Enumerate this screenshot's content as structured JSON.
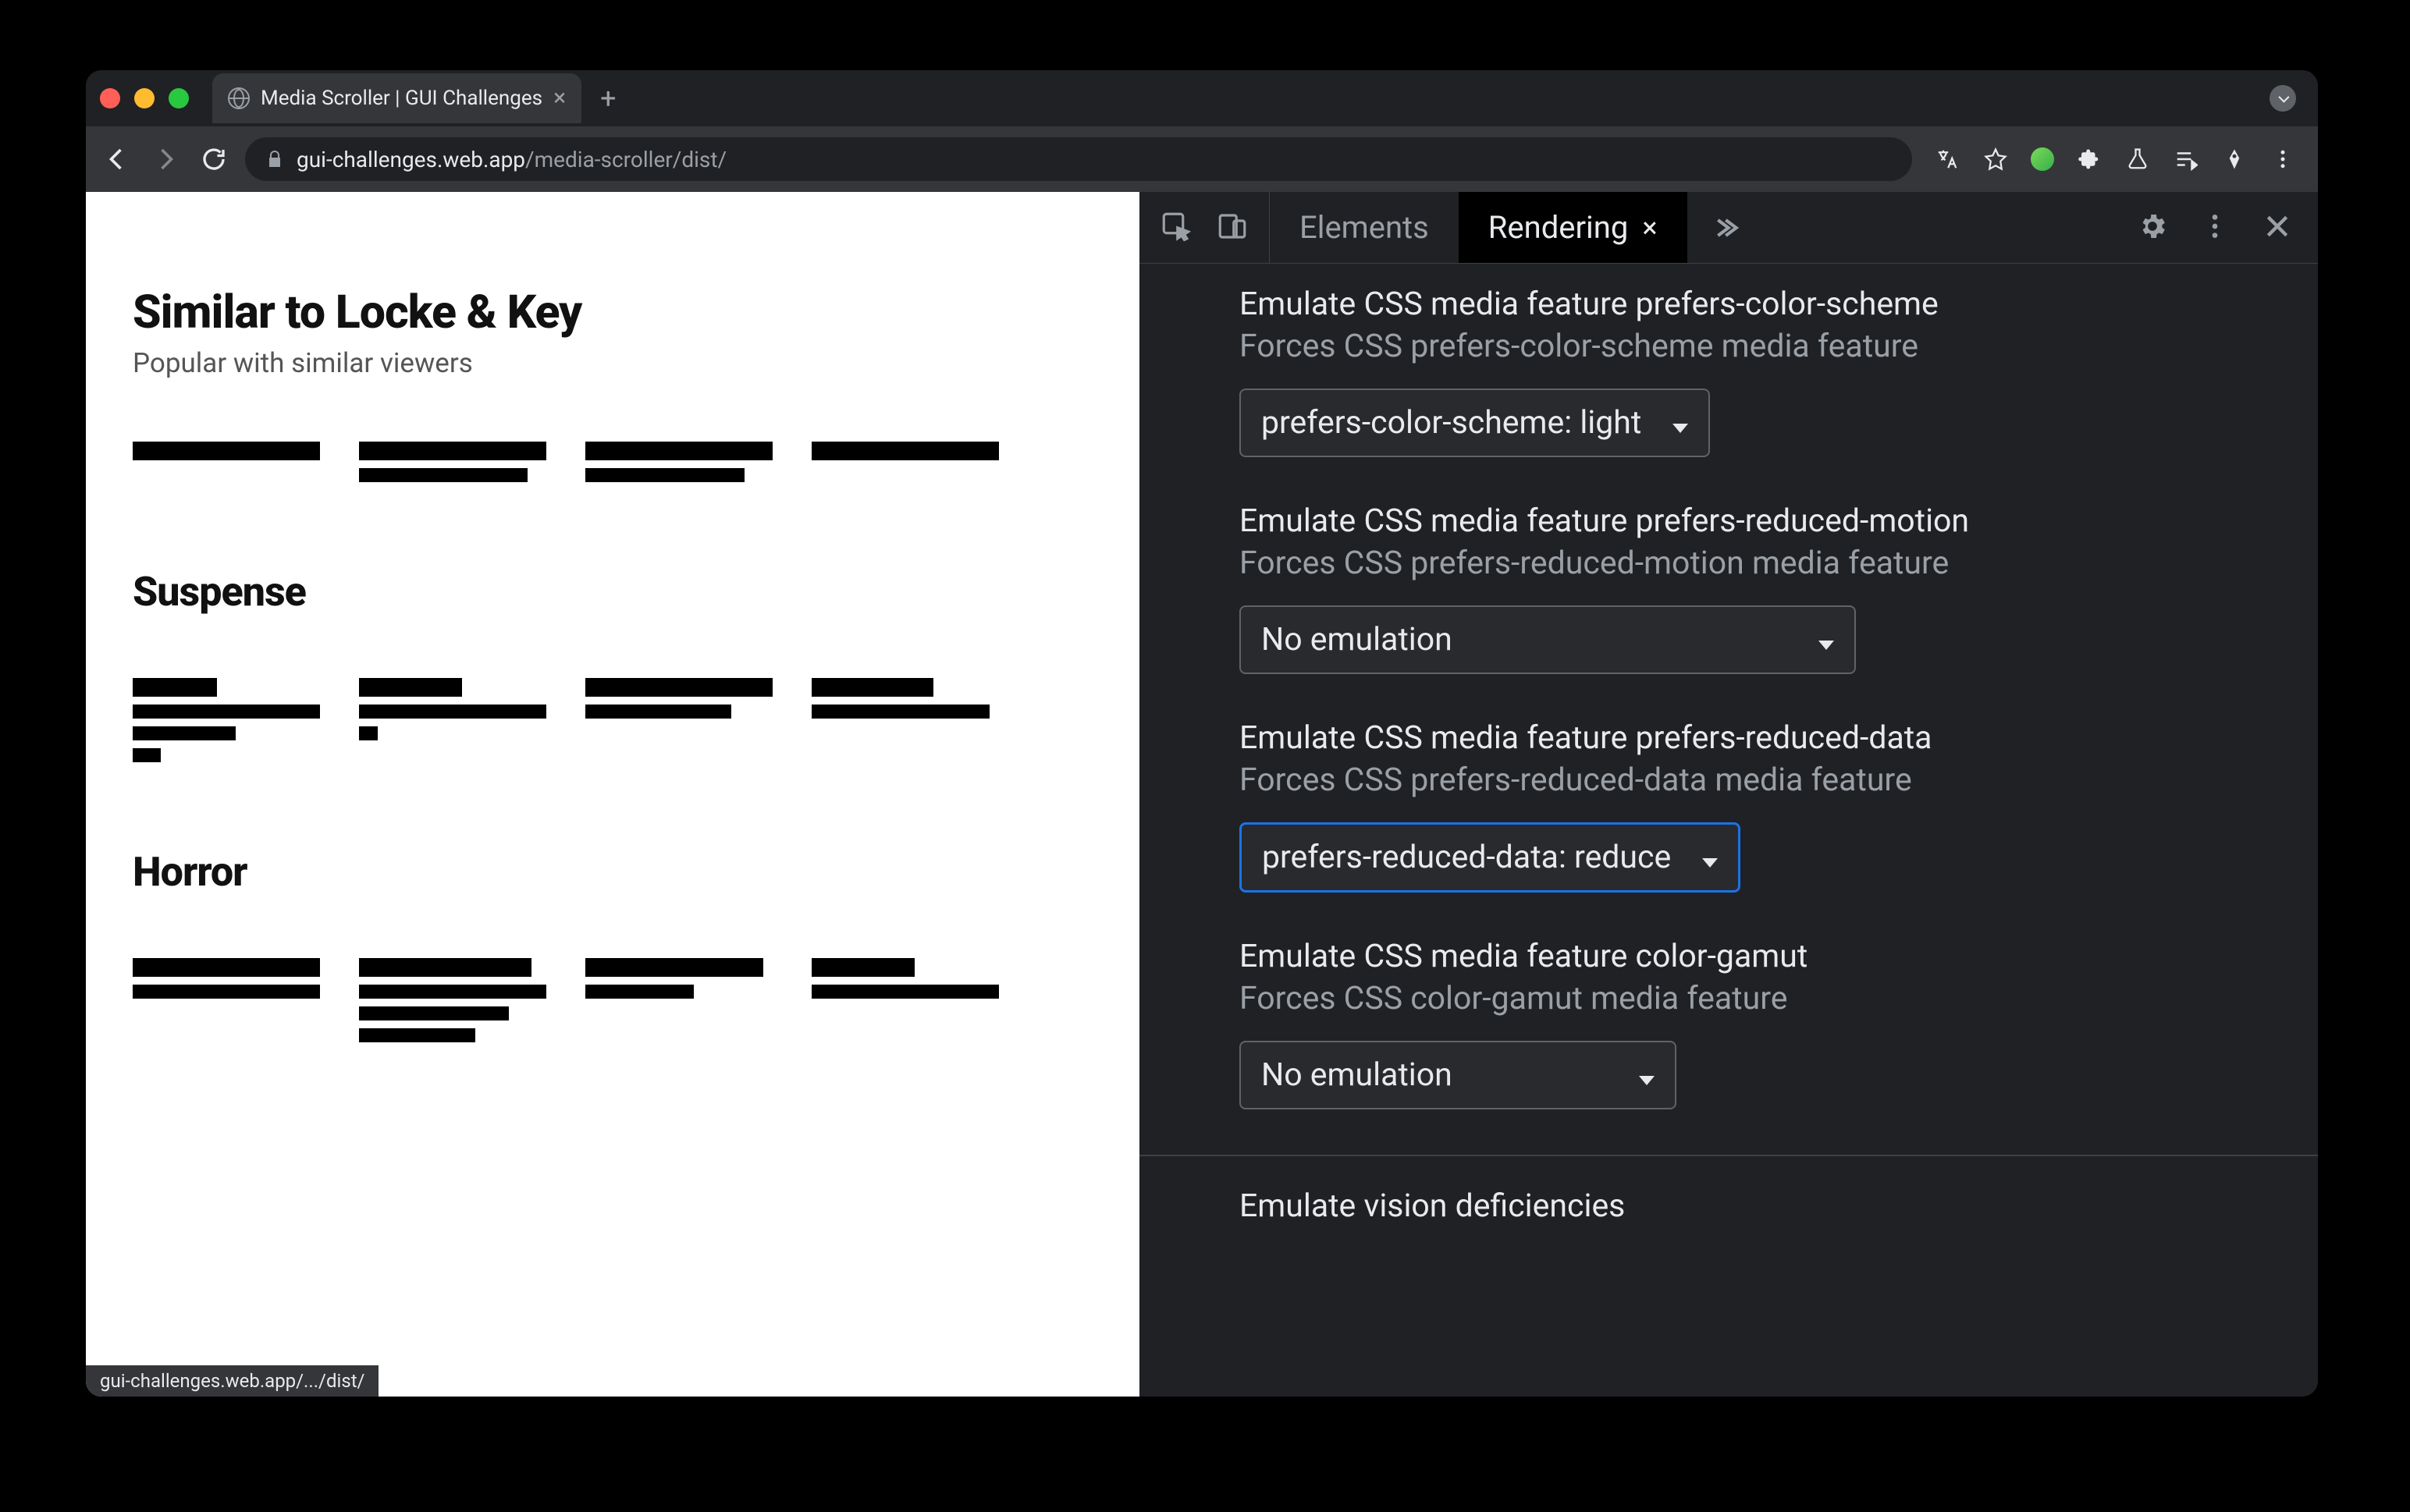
{
  "tab": {
    "title": "Media Scroller | GUI Challenges"
  },
  "url": {
    "host": "gui-challenges.web.app",
    "path": "/media-scroller/dist/"
  },
  "status_bar": "gui-challenges.web.app/.../dist/",
  "page": {
    "sections": [
      {
        "heading": "Similar to Locke & Key",
        "subtitle": "Popular with similar viewers",
        "cards": [
          {
            "bars": [
              100
            ]
          },
          {
            "bars": [
              100,
              90
            ]
          },
          {
            "bars": [
              100,
              85
            ]
          },
          {
            "bars": [
              100
            ]
          }
        ]
      },
      {
        "heading": "Suspense",
        "subtitle": "",
        "cards": [
          {
            "bars": [
              45,
              100,
              55,
              15
            ]
          },
          {
            "bars": [
              55,
              100,
              10
            ]
          },
          {
            "bars": [
              100,
              78
            ]
          },
          {
            "bars": [
              65,
              95
            ]
          }
        ]
      },
      {
        "heading": "Horror",
        "subtitle": "",
        "cards": [
          {
            "bars": [
              100,
              100
            ]
          },
          {
            "bars": [
              92,
              100,
              80,
              62
            ]
          },
          {
            "bars": [
              95,
              58
            ]
          },
          {
            "bars": [
              55,
              100
            ]
          }
        ]
      }
    ]
  },
  "devtools": {
    "tabs": {
      "elements": "Elements",
      "rendering": "Rendering"
    },
    "settings": [
      {
        "title": "Emulate CSS media feature prefers-color-scheme",
        "desc": "Forces CSS prefers-color-scheme media feature",
        "value": "prefers-color-scheme: light",
        "focused": false,
        "wide": false
      },
      {
        "title": "Emulate CSS media feature prefers-reduced-motion",
        "desc": "Forces CSS prefers-reduced-motion media feature",
        "value": "No emulation",
        "focused": false,
        "wide": true
      },
      {
        "title": "Emulate CSS media feature prefers-reduced-data",
        "desc": "Forces CSS prefers-reduced-data media feature",
        "value": "prefers-reduced-data: reduce",
        "focused": true,
        "wide": false
      },
      {
        "title": "Emulate CSS media feature color-gamut",
        "desc": "Forces CSS color-gamut media feature",
        "value": "No emulation",
        "focused": false,
        "wide": false
      }
    ],
    "vision_title": "Emulate vision deficiencies"
  }
}
